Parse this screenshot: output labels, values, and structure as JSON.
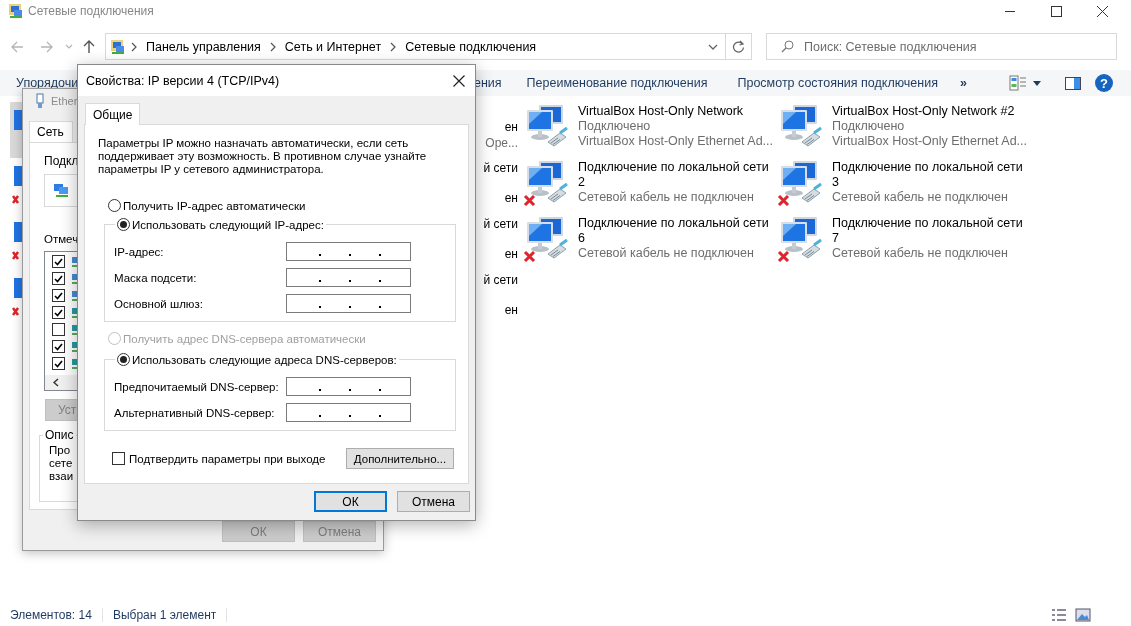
{
  "window": {
    "title": "Сетевые подключения"
  },
  "address_bar": {
    "breadcrumbs": [
      "Панель управления",
      "Сеть и Интернет",
      "Сетевые подключения"
    ]
  },
  "search": {
    "placeholder": "Поиск: Сетевые подключения"
  },
  "command_bar": {
    "items": [
      "Упорядочи",
      "ения",
      "Переименование подключения",
      "Просмотр состояния подключения"
    ],
    "more": "»",
    "help": "?"
  },
  "edge_items": [
    {
      "selected": true,
      "disconnected": false
    },
    {
      "selected": false,
      "disconnected": true
    },
    {
      "selected": false,
      "disconnected": true
    },
    {
      "selected": false,
      "disconnected": true
    }
  ],
  "hidden_column_fragments": [
    {
      "status": "ен",
      "device": "Ope..."
    },
    {
      "name": "й сети",
      "status": "ен"
    },
    {
      "name": "й сети",
      "status": "ен"
    },
    {
      "name": "й сети",
      "status": "ен"
    }
  ],
  "connections": [
    {
      "name": "VirtualBox Host-Only Network",
      "status": "Подключено",
      "device": "VirtualBox Host-Only Ethernet Ad...",
      "disconnected": false
    },
    {
      "name": "VirtualBox Host-Only Network #2",
      "status": "Подключено",
      "device": "VirtualBox Host-Only Ethernet Ad...",
      "disconnected": false
    },
    {
      "name": "Подключение по локальной сети 2",
      "status": "Сетевой кабель не подключен",
      "disconnected": true
    },
    {
      "name": "Подключение по локальной сети 3",
      "status": "Сетевой кабель не подключен",
      "disconnected": true
    },
    {
      "name": "Подключение по локальной сети 6",
      "status": "Сетевой кабель не подключен",
      "disconnected": true
    },
    {
      "name": "Подключение по локальной сети 7",
      "status": "Сетевой кабель не подключен",
      "disconnected": true
    }
  ],
  "status_bar": {
    "count": "Элементов: 14",
    "selection": "Выбран 1 элемент"
  },
  "ethernet_dialog": {
    "title": "Ether",
    "tabs": [
      {
        "label": "Сеть",
        "selected": true
      }
    ],
    "connect_label": "Подкл",
    "components_label": "Отмеч",
    "components": [
      {
        "checked": true
      },
      {
        "checked": true
      },
      {
        "checked": true
      },
      {
        "checked": true
      },
      {
        "checked": false
      },
      {
        "checked": true
      },
      {
        "checked": true
      }
    ],
    "install_button": "Уст",
    "description_group": "Опис",
    "description_lines": [
      "Про",
      "сете",
      "взаи"
    ],
    "buttons": [
      {
        "label": "ОК",
        "disabled": true
      },
      {
        "label": "Отмена",
        "disabled": true
      }
    ]
  },
  "ipv4_dialog": {
    "title": "Свойства: IP версии 4 (TCP/IPv4)",
    "tabs": [
      {
        "label": "Общие",
        "selected": true
      }
    ],
    "description_lines": [
      "Параметры IP можно назначать автоматически, если сеть",
      "поддерживает эту возможность. В противном случае узнайте",
      "параметры IP у сетевого администратора."
    ],
    "ip_mode": [
      {
        "label": "Получить IP-адрес автоматически",
        "selected": false,
        "disabled": false
      },
      {
        "label": "Использовать следующий IP-адрес:",
        "selected": true,
        "disabled": false
      }
    ],
    "ip_fields": [
      {
        "label": "IP-адрес:"
      },
      {
        "label": "Маска подсети:"
      },
      {
        "label": "Основной шлюз:"
      }
    ],
    "dns_mode": [
      {
        "label": "Получить адрес DNS-сервера автоматически",
        "selected": false,
        "disabled": true
      },
      {
        "label": "Использовать следующие адреса DNS-серверов:",
        "selected": true,
        "disabled": false
      }
    ],
    "dns_fields": [
      {
        "label": "Предпочитаемый DNS-сервер:"
      },
      {
        "label": "Альтернативный DNS-сервер:"
      }
    ],
    "validate": {
      "label": "Подтвердить параметры при выходе",
      "checked": false
    },
    "advanced_button": "Дополнительно...",
    "buttons": [
      {
        "label": "ОК",
        "default": true
      },
      {
        "label": "Отмена",
        "default": false
      }
    ]
  }
}
